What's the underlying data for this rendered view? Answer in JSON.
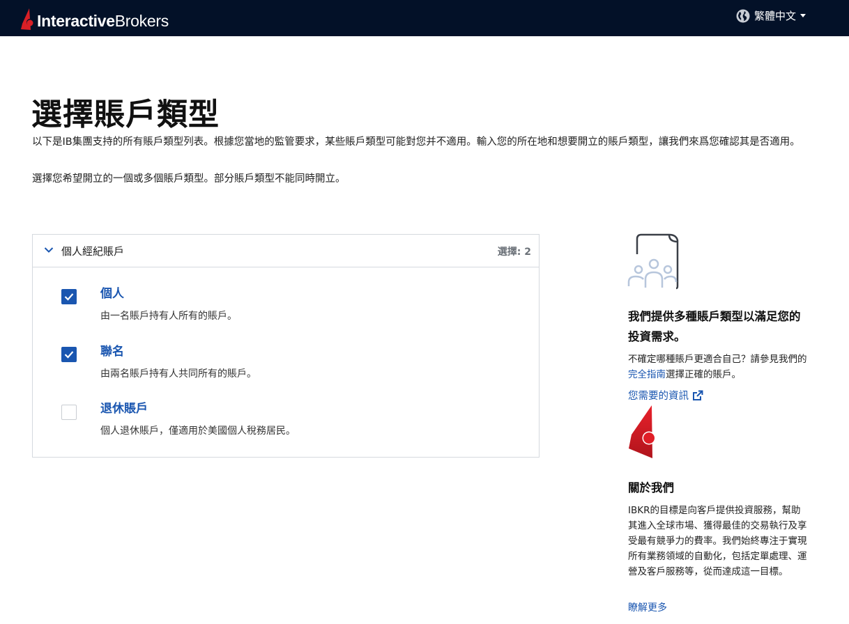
{
  "header": {
    "logo_bold": "Interactive",
    "logo_light": "Brokers",
    "language": "繁體中文",
    "icons": {
      "globe": "globe-icon",
      "caret": "caret-down-icon"
    }
  },
  "main": {
    "title": "選擇賬戶類型",
    "intro": "以下是IB集團支持的所有賬戶類型列表。根據您當地的監管要求，某些賬戶類型可能對您并不適用。輸入您的所在地和想要開立的賬戶類型，讓我們來爲您確認其是否適用。",
    "instruction": "選擇您希望開立的一個或多個賬戶類型。部分賬戶類型不能同時開立。"
  },
  "accordion": {
    "title": "個人經紀賬戶",
    "count_label": "選擇:",
    "count_value": "2",
    "options": [
      {
        "title": "個人",
        "desc": "由一名賬戶持有人所有的賬戶。",
        "checked": true
      },
      {
        "title": "聯名",
        "desc": "由兩名賬戶持有人共同所有的賬戶。",
        "checked": true
      },
      {
        "title": "退休賬戶",
        "desc": "個人退休賬戶，僅適用於美國個人稅務居民。",
        "checked": false
      }
    ]
  },
  "sidebar": {
    "heading": "我們提供多種賬戶類型以滿足您的投資需求。",
    "text_before": "不確定哪種賬戶更適合自己？請參見我們的",
    "guide_link": "完全指南",
    "text_after": "選擇正確的賬戶。",
    "info_link": "您需要的資訊",
    "about_title": "關於我們",
    "about_text": "IBKR的目標是向客戶提供投資服務，幫助其進入全球市場、獲得最佳的交易執行及享受最有競爭力的費率。我們始終專注于實現所有業務領域的自動化，包括定單處理、運營及客戶服務等，從而達成這一目標。",
    "more_link": "瞭解更多"
  },
  "colors": {
    "topbar": "#031128",
    "accent_blue": "#1a56b0",
    "brand_red": "#d81f26"
  }
}
